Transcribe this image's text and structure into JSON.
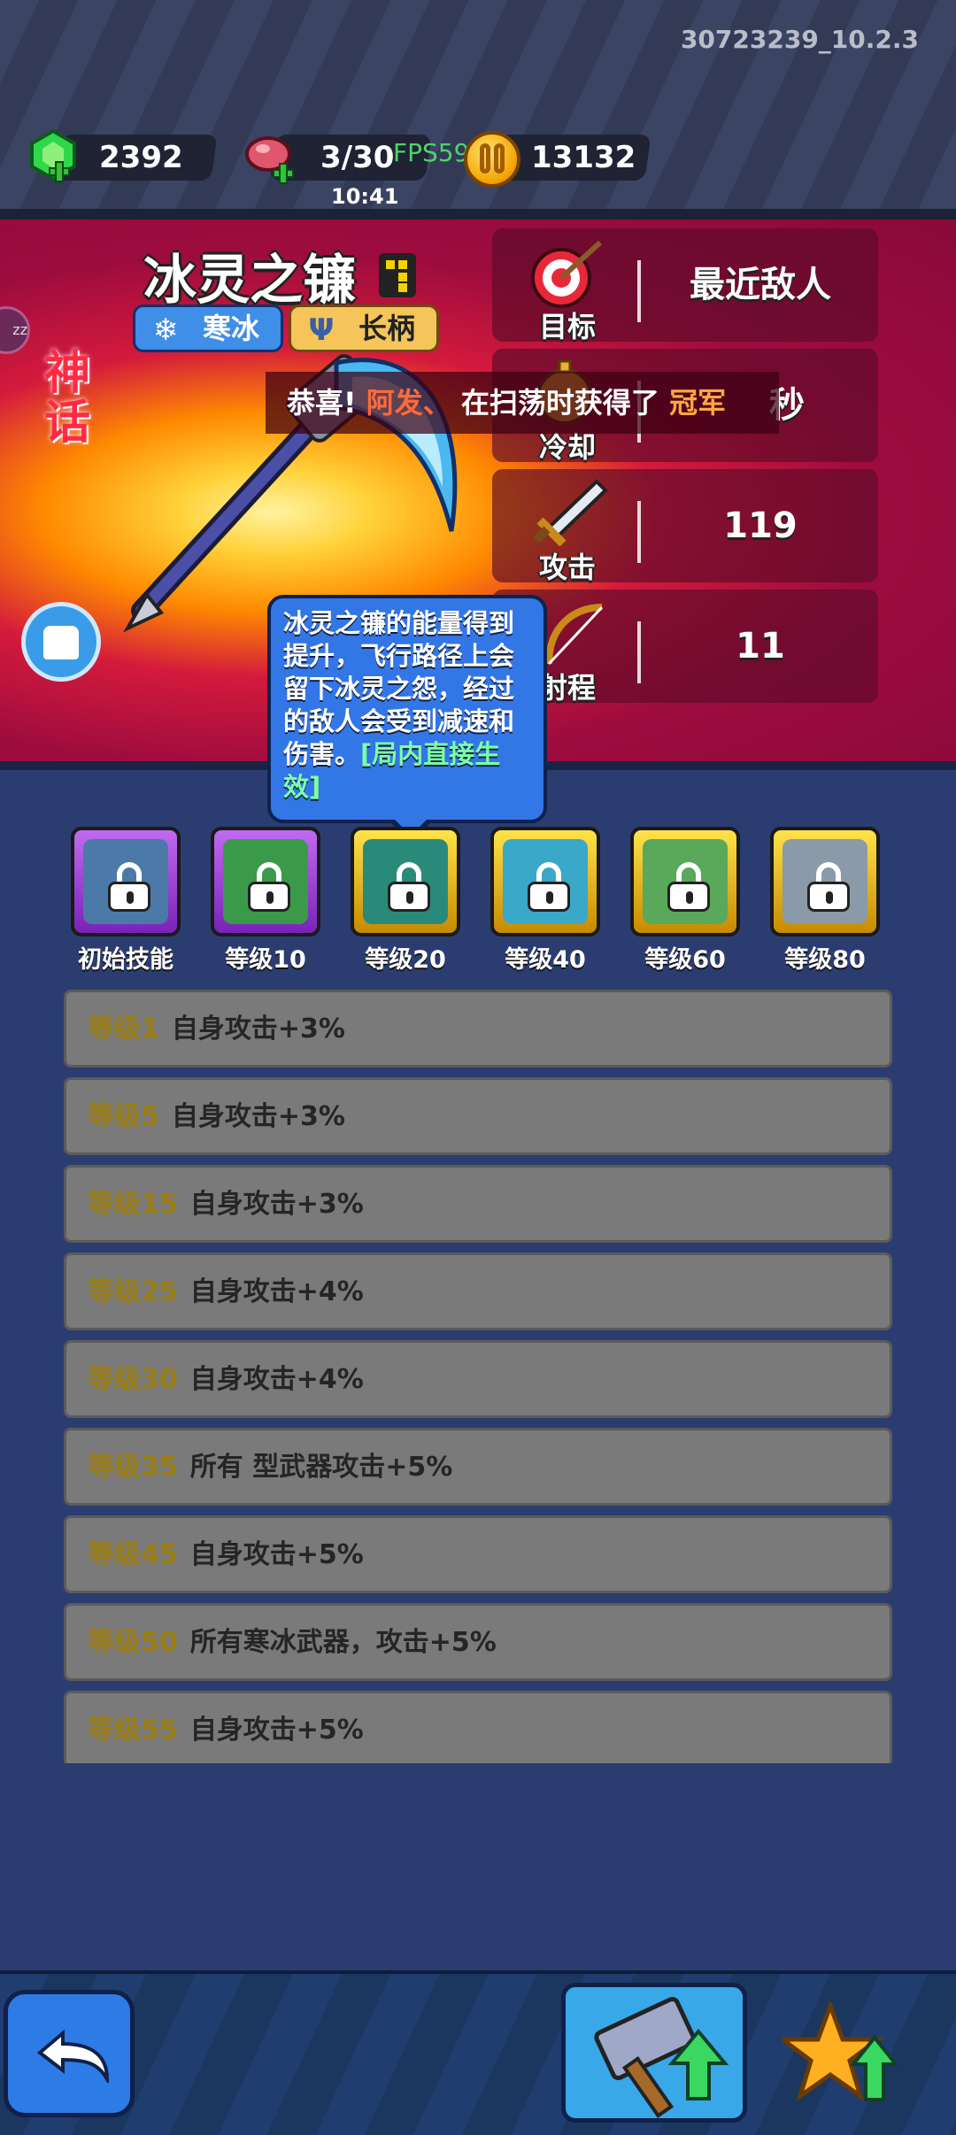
{
  "build_version": "30723239_10.2.3",
  "resources": {
    "gems": "2392",
    "stamina": "3/30",
    "fps": "FPS59",
    "timer": "10:41",
    "coins": "13132"
  },
  "weapon": {
    "name": "冰灵之镰",
    "rarity": "神话",
    "tags": [
      {
        "label": "寒冰",
        "icon": "snowflake-icon"
      },
      {
        "label": "长柄",
        "icon": "trident-icon"
      }
    ]
  },
  "stats": [
    {
      "label": "目标",
      "value": "最近敌人",
      "icon": "target-icon"
    },
    {
      "label": "冷却",
      "value": "秒",
      "icon": "stopwatch-icon"
    },
    {
      "label": "攻击",
      "value": "119",
      "icon": "sword-icon"
    },
    {
      "label": "射程",
      "value": "11",
      "icon": "bow-icon"
    }
  ],
  "broadcast": {
    "prefix": "恭喜!",
    "name": "阿发、",
    "text": "在扫荡时获得了",
    "trophy": "冠军"
  },
  "tooltip": {
    "text": "冰灵之镰的能量得到提升，飞行路径上会留下冰灵之怨，经过的敌人会受到减速和伤害。",
    "highlight": "[局内直接生效]"
  },
  "skills": [
    {
      "label": "初始技能",
      "frame": "purple"
    },
    {
      "label": "等级10",
      "frame": "purple"
    },
    {
      "label": "等级20",
      "frame": "gold"
    },
    {
      "label": "等级40",
      "frame": "gold"
    },
    {
      "label": "等级60",
      "frame": "gold"
    },
    {
      "label": "等级80",
      "frame": "gold"
    }
  ],
  "level_bonuses": [
    {
      "level": "等级1",
      "text": "自身攻击+3%"
    },
    {
      "level": "等级5",
      "text": "自身攻击+3%"
    },
    {
      "level": "等级15",
      "text": "自身攻击+3%"
    },
    {
      "level": "等级25",
      "text": "自身攻击+4%"
    },
    {
      "level": "等级30",
      "text": "自身攻击+4%"
    },
    {
      "level": "等级35",
      "text": "所有 型武器攻击+5%"
    },
    {
      "level": "等级45",
      "text": "自身攻击+5%"
    },
    {
      "level": "等级50",
      "text": "所有寒冰武器，攻击+5%"
    },
    {
      "level": "等级55",
      "text": "自身攻击+5%"
    }
  ],
  "bottom_actions": [
    "back-button",
    "upgrade-hammer-button",
    "star-upgrade-button"
  ],
  "colors": {
    "hero_bg": "#9e0c3e",
    "page_bg": "#2b3d70",
    "level_text": "#9a7d12",
    "highlight_green": "#7dffa6"
  }
}
